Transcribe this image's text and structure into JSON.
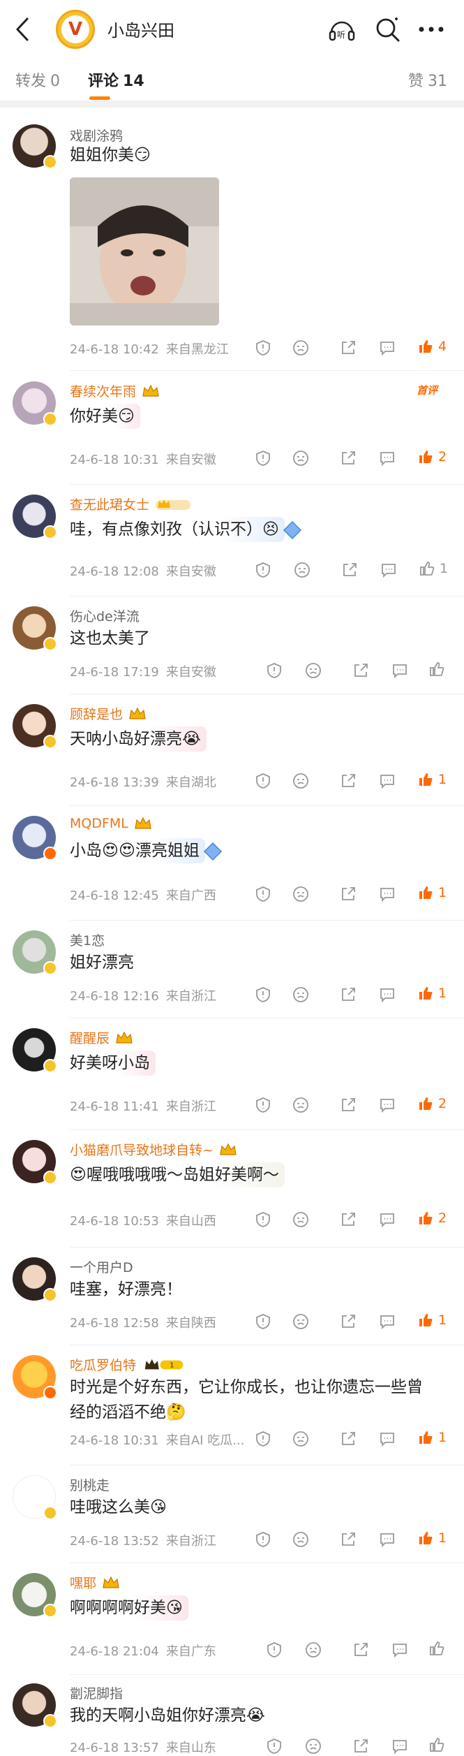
{
  "header": {
    "title": "小岛兴田",
    "avatar_letter": "V"
  },
  "tabs": {
    "repost_label": "转发",
    "repost_count": "0",
    "comment_label": "评论",
    "comment_count": "14",
    "like_label": "赞",
    "like_count": "31"
  },
  "comments": [
    {
      "name": "戏剧涂鸦",
      "text": "姐姐你美😏",
      "time": "24-6-18 10:42",
      "loc": "来自黑龙江",
      "likes": "4",
      "liked": true
    },
    {
      "name": "春续次年雨",
      "text": "你好美😏",
      "time": "24-6-18 10:31",
      "loc": "来自安徽",
      "likes": "2",
      "liked": true,
      "tag": "首评"
    },
    {
      "name": "查无此珺女士",
      "text": "哇，有点像刘孜（认识不）😣",
      "time": "24-6-18 12:08",
      "loc": "来自安徽",
      "likes": "1",
      "liked": false
    },
    {
      "name": "伤心de洋流",
      "text": "这也太美了",
      "time": "24-6-18 17:19",
      "loc": "来自安徽",
      "likes": "",
      "liked": false
    },
    {
      "name": "顾辞是也",
      "text": "天呐小岛好漂亮😭",
      "time": "24-6-18 13:39",
      "loc": "来自湖北",
      "likes": "1",
      "liked": true
    },
    {
      "name": "MQDFML",
      "text": "小岛😍😍漂亮姐姐",
      "time": "24-6-18 12:45",
      "loc": "来自广西",
      "likes": "1",
      "liked": true
    },
    {
      "name": "美1恋",
      "text": "姐好漂亮",
      "time": "24-6-18 12:16",
      "loc": "来自浙江",
      "likes": "1",
      "liked": true
    },
    {
      "name": "醒醒辰",
      "text": "好美呀小岛",
      "time": "24-6-18 11:41",
      "loc": "来自浙江",
      "likes": "2",
      "liked": true
    },
    {
      "name": "小猫磨爪导致地球自转~",
      "text": "😍喔哦哦哦哦～岛姐好美啊～",
      "time": "24-6-18 10:53",
      "loc": "来自山西",
      "likes": "2",
      "liked": true
    },
    {
      "name": "一个用户D",
      "text": "哇塞，好漂亮！",
      "time": "24-6-18 12:58",
      "loc": "来自陕西",
      "likes": "1",
      "liked": true
    },
    {
      "name": "吃瓜罗伯特",
      "text_line1": "时光是个好东西，它让你成长，也让你遗忘一些曾",
      "text_line2": "经的滔滔不绝🤔",
      "time": "24-6-18 10:31",
      "loc": "来自AI 吃瓜...",
      "likes": "1",
      "liked": true
    },
    {
      "name": "别桃走",
      "text": "哇哦这么美😘",
      "time": "24-6-18 13:52",
      "loc": "来自浙江",
      "likes": "1",
      "liked": true
    },
    {
      "name": "嘿耶",
      "text": "啊啊啊啊好美😘",
      "time": "24-6-18 21:04",
      "loc": "来自广东",
      "likes": "",
      "liked": false
    },
    {
      "name": "劏泥脚指",
      "text": "我的天啊小岛姐你好漂亮😭",
      "time": "24-6-18 13:57",
      "loc": "来自山东",
      "likes": "",
      "liked": false
    }
  ],
  "colors": {
    "accent": "#ff8200",
    "like_active": "#ff6a00",
    "vip_name": "#e8761a"
  },
  "icons": [
    "back-arrow-icon",
    "listen-icon",
    "search-icon",
    "more-icon",
    "shield-icon",
    "emoji-icon",
    "share-icon",
    "comment-icon",
    "like-icon"
  ]
}
